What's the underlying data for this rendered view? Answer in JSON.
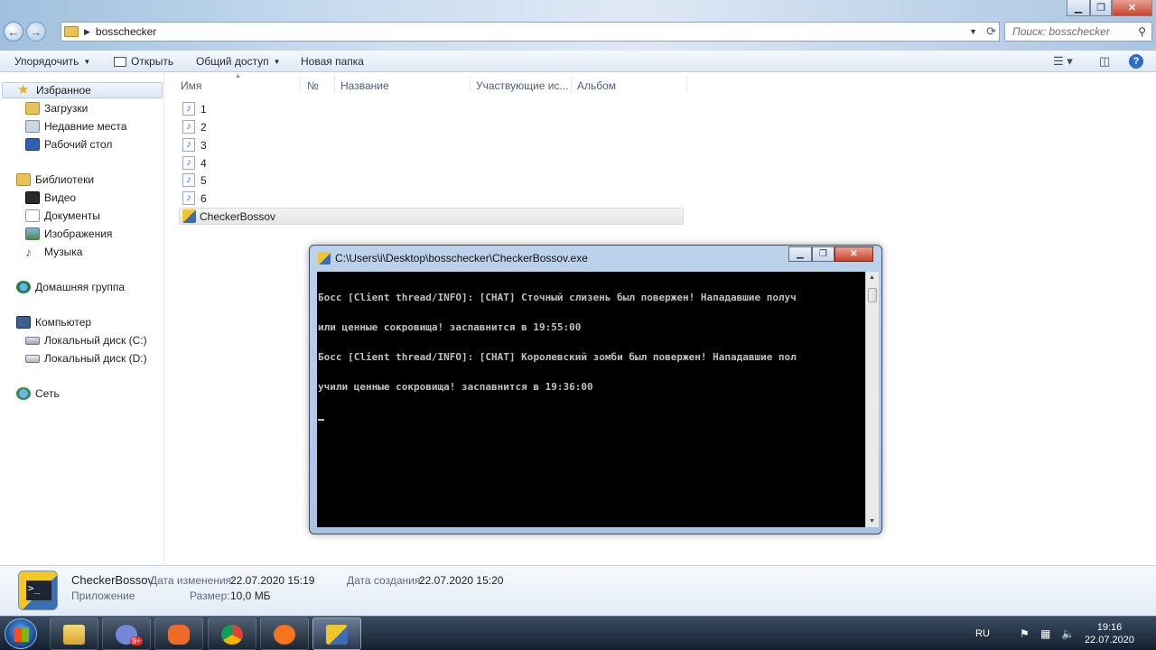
{
  "explorer": {
    "address": {
      "path": "bosschecker"
    },
    "search": {
      "placeholder": "Поиск: bosschecker"
    },
    "toolbar": {
      "organize": "Упорядочить",
      "open": "Открыть",
      "share": "Общий доступ",
      "new_folder": "Новая папка"
    },
    "nav": {
      "favorites": "Избранное",
      "downloads": "Загрузки",
      "recent": "Недавние места",
      "desktop": "Рабочий стол",
      "libraries": "Библиотеки",
      "video": "Видео",
      "documents": "Документы",
      "images": "Изображения",
      "music": "Музыка",
      "homegroup": "Домашняя группа",
      "computer": "Компьютер",
      "disk_c": "Локальный диск (C:)",
      "disk_d": "Локальный диск (D:)",
      "network": "Сеть"
    },
    "columns": {
      "name": "Имя",
      "number": "№",
      "title": "Название",
      "artists": "Участвующие ис...",
      "album": "Альбом"
    },
    "files": [
      "1",
      "2",
      "3",
      "4",
      "5",
      "6",
      "CheckerBossov"
    ],
    "details": {
      "name": "CheckerBossov",
      "type": "Приложение",
      "modified_label": "Дата изменения:",
      "modified_value": "22.07.2020 15:19",
      "created_label": "Дата создания:",
      "created_value": "22.07.2020 15:20",
      "size_label": "Размер:",
      "size_value": "10,0 МБ"
    }
  },
  "console": {
    "title": "C:\\Users\\i\\Desktop\\bosschecker\\CheckerBossov.exe",
    "lines": [
      "Босс [Client thread/INFO]: [CHAT] Сточный слизень был повержен! Нападавшие получ",
      "или ценные сокровища! заспавнится в 19:55:00",
      "Босс [Client thread/INFO]: [CHAT] Королевский зомби был повержен! Нападавшие пол",
      "учили ценные сокровища! заспавнится в 19:36:00"
    ]
  },
  "taskbar": {
    "language": "RU",
    "time": "19:16",
    "date": "22.07.2020",
    "discord_badge": "9+"
  },
  "colors": {
    "console_bg": "#000000",
    "console_text": "#c0c0c0",
    "close_button": "#c8452c",
    "taskbar": "#14202e"
  }
}
